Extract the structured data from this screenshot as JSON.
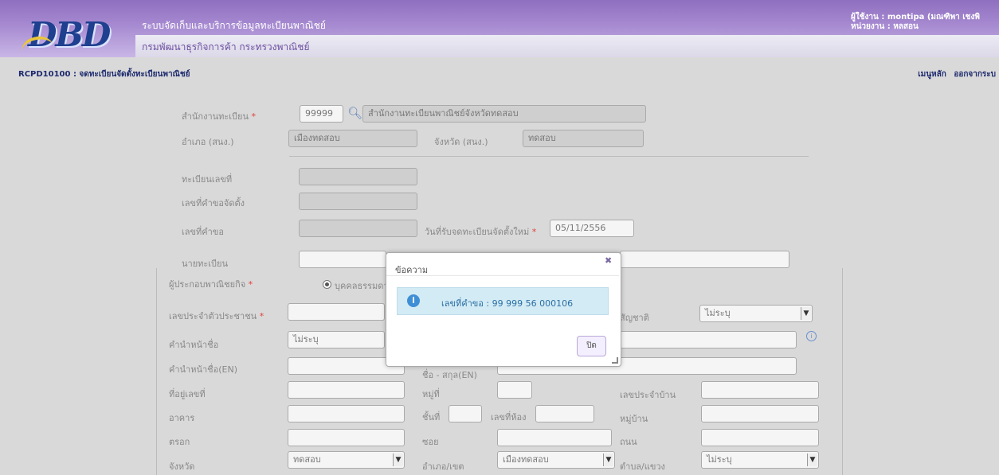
{
  "header": {
    "logo_text": "DBD",
    "system_title": "ระบบจัดเก็บและบริการข้อมูลทะเบียนพาณิชย์",
    "department": "กรมพัฒนาธุรกิจการค้า  กระทรวงพาณิชย์",
    "user_line1": "ผู้ใช้งาน : montipa (มณฑิพา เชงพิ",
    "user_line2": "หน่วยงาน : หลสอน"
  },
  "page": {
    "code_title": "RCPD10100 : จดทะเบียนจัดตั้งทะเบียนพาณิชย์",
    "menu_main": "เมนูหลัก",
    "menu_logout": "ออกจากระบ"
  },
  "form": {
    "office_label": "สำนักงานทะเบียน",
    "required_mark": "*",
    "office_code": "99999",
    "office_name": "สำนักงานทะเบียนพาณิชย์จังหวัดทดสอบ",
    "district_label": "อำเภอ (สนง.)",
    "district_value": "เมืองทดสอบ",
    "province_label": "จังหวัด (สนง.)",
    "province_value": "ทดสอบ",
    "regno_label": "ทะเบียนเลขที่",
    "setup_no_label": "เลขที่คำขอจัดตั้ง",
    "request_no_label": "เลขที่คำขอ",
    "reg_date_label": "วันที่รับจดทะเบียนจัดตั้งใหม่",
    "reg_date_value": "05/11/2556",
    "registrar_label": "นายทะเบียน",
    "operator_label": "ผู้ประกอบพาณิชยกิจ",
    "operator_option": "บุคคลธรรมดา",
    "idcard_label": "เลขประจำตัวประชาชน",
    "nationality_label": "สัญชาติ",
    "nationality_value": "ไม่ระบุ",
    "prefix_label": "คำนำหน้าชื่อ",
    "prefix_value": "ไม่ระบุ",
    "prefix_en_label": "คำนำหน้าชื่อ(EN)",
    "name_en_label": "ชื่อ - สกุล(EN)",
    "address_no_label": "ที่อยู่เลขที่",
    "moo_label": "หมู่ที่",
    "house_code_label": "เลขประจำบ้าน",
    "building_label": "อาคาร",
    "floor_label": "ชั้นที่",
    "room_label": "เลขที่ห้อง",
    "village_label": "หมู่บ้าน",
    "alley_label": "ตรอก",
    "soi_label": "ซอย",
    "road_label": "ถนน",
    "province2_label": "จังหวัด",
    "province2_value": "ทดสอบ",
    "amphoe_label": "อำเภอ/เขต",
    "amphoe_value": "เมืองทดสอบ",
    "tambon_label": "ตำบล/แขวง",
    "tambon_value": "ไม่ระบุ"
  },
  "dialog": {
    "title": "ข้อความ",
    "close_symbol": "✖",
    "message": "เลขที่คำขอ : 99 999 56 000106",
    "ok_label": "ปิด"
  },
  "colors": {
    "header_purple": "#8e6fc0",
    "logo_blue": "#1f3f8f",
    "info_blue": "#3f8fd6",
    "required_red": "#e0413a"
  }
}
